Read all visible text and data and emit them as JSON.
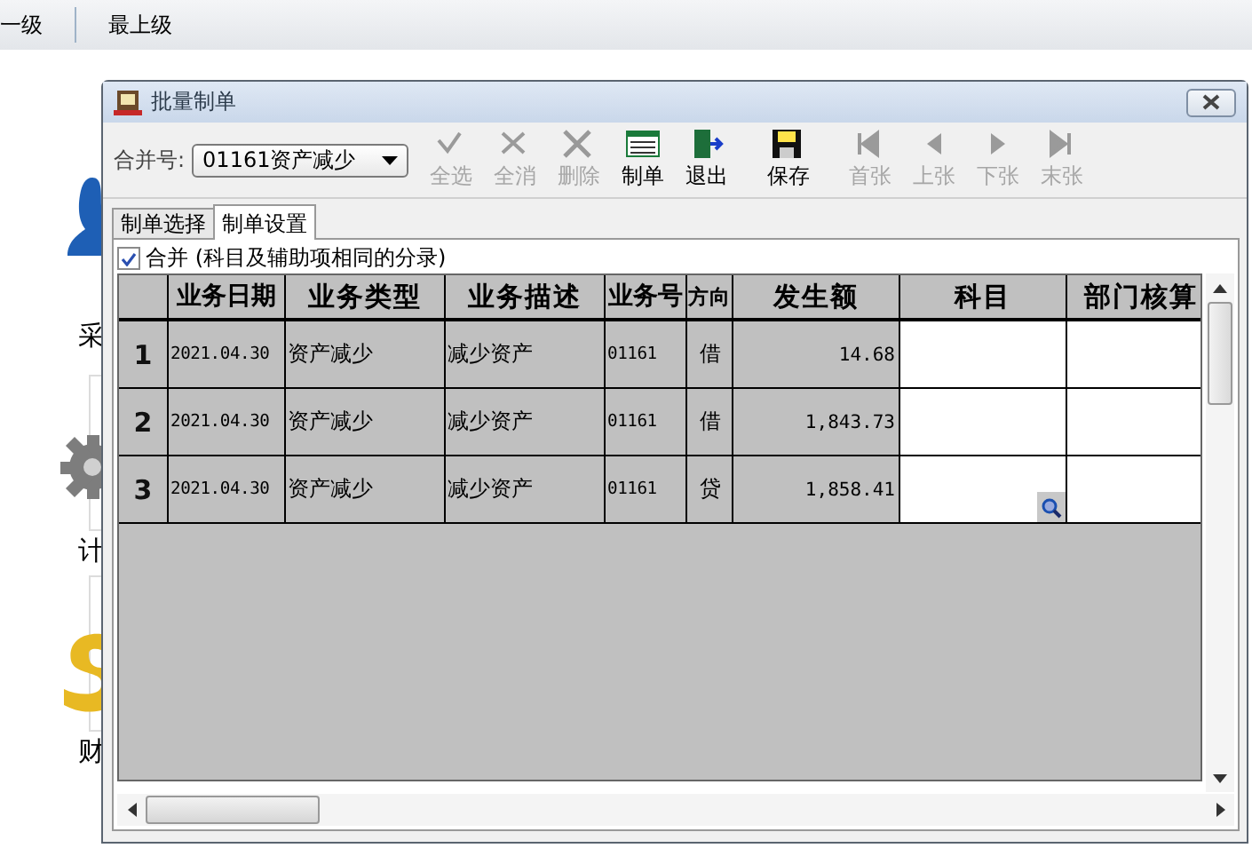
{
  "nav": {
    "items": [
      {
        "label": "一级"
      },
      {
        "label": "最上级"
      }
    ]
  },
  "desktop": {
    "icons": [
      {
        "kind": "person",
        "label": "采"
      },
      {
        "kind": "gear",
        "label": "计"
      },
      {
        "kind": "money",
        "label": "财"
      }
    ]
  },
  "dialog": {
    "title": "批量制单",
    "merge_field": {
      "label": "合并号:",
      "value": "01161资产减少"
    },
    "toolbar": [
      {
        "kind": "select-all",
        "label": "全选",
        "disabled": true
      },
      {
        "kind": "clear-all",
        "label": "全消",
        "disabled": true
      },
      {
        "kind": "delete",
        "label": "删除",
        "disabled": true
      },
      {
        "kind": "make",
        "label": "制单",
        "disabled": false
      },
      {
        "kind": "exit",
        "label": "退出",
        "disabled": false
      },
      {
        "kind": "save",
        "label": "保存",
        "disabled": false
      },
      {
        "kind": "first",
        "label": "首张",
        "disabled": true
      },
      {
        "kind": "prev",
        "label": "上张",
        "disabled": true
      },
      {
        "kind": "next",
        "label": "下张",
        "disabled": true
      },
      {
        "kind": "last",
        "label": "末张",
        "disabled": true
      }
    ],
    "tabs": [
      {
        "label": "制单选择",
        "selected": false
      },
      {
        "label": "制单设置",
        "selected": true
      }
    ],
    "merge_checkbox": {
      "label": "合并 (科目及辅助项相同的分录)",
      "checked": true
    },
    "table": {
      "columns": [
        "业务日期",
        "业务类型",
        "业务描述",
        "业务号",
        "方向",
        "发生额",
        "科目",
        "部门核算"
      ],
      "rows": [
        {
          "number": "1",
          "cells": [
            "2021.04.30",
            "资产减少",
            "减少资产",
            "01161",
            "借",
            "14.68",
            "",
            ""
          ],
          "lookup_button": false
        },
        {
          "number": "2",
          "cells": [
            "2021.04.30",
            "资产减少",
            "减少资产",
            "01161",
            "借",
            "1,843.73",
            "",
            ""
          ],
          "lookup_button": false
        },
        {
          "number": "3",
          "cells": [
            "2021.04.30",
            "资产减少",
            "减少资产",
            "01161",
            "贷",
            "1,858.41",
            "",
            ""
          ],
          "lookup_button": true
        }
      ]
    }
  }
}
